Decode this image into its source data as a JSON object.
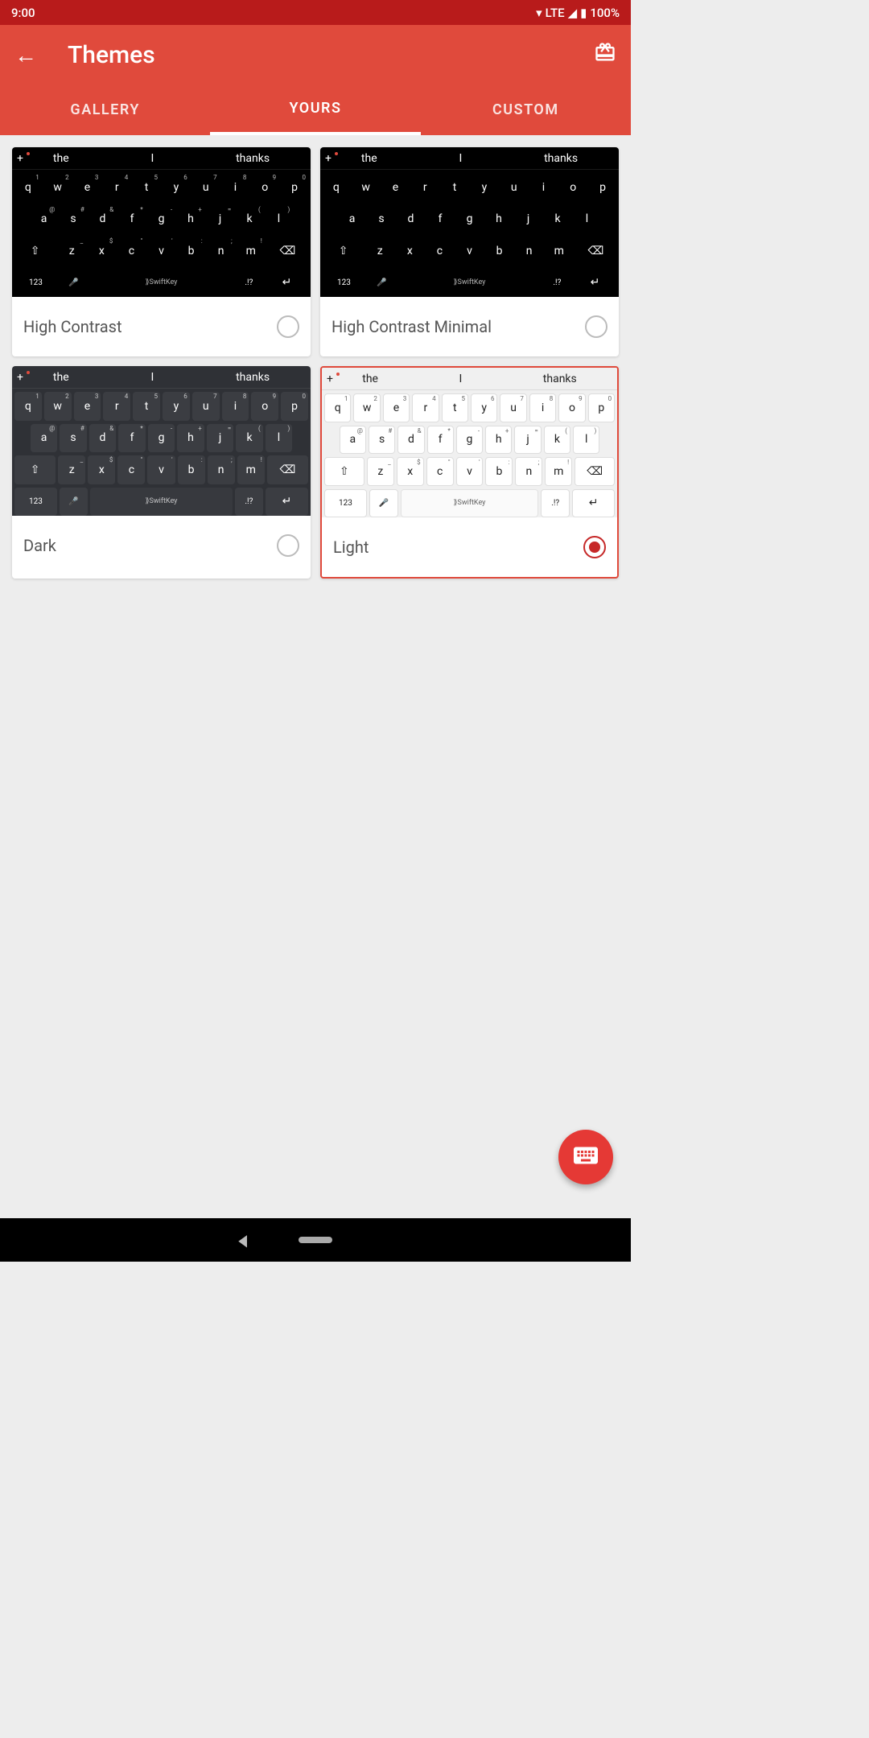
{
  "status": {
    "time": "9:00",
    "network": "LTE",
    "battery": "100%"
  },
  "app": {
    "title": "Themes"
  },
  "tabs": {
    "gallery": "GALLERY",
    "yours": "YOURS",
    "custom": "CUSTOM",
    "active": "yours"
  },
  "suggestions": {
    "s1": "the",
    "s2": "I",
    "s3": "thanks"
  },
  "keys": {
    "row1": [
      "q",
      "w",
      "e",
      "r",
      "t",
      "y",
      "u",
      "i",
      "o",
      "p"
    ],
    "row1nums": [
      "1",
      "2",
      "3",
      "4",
      "5",
      "6",
      "7",
      "8",
      "9",
      "0"
    ],
    "row2": [
      "a",
      "s",
      "d",
      "f",
      "g",
      "h",
      "j",
      "k",
      "l"
    ],
    "row2syms": [
      "@",
      "#",
      "&",
      "*",
      "-",
      "+",
      "=",
      "(",
      ")"
    ],
    "row3": [
      "z",
      "x",
      "c",
      "v",
      "b",
      "n",
      "m"
    ],
    "row3syms": [
      "_",
      "$",
      "\"",
      "'",
      ":",
      ";",
      "!"
    ],
    "numkey": "123",
    "brand": "SwiftKey"
  },
  "themes": {
    "hc": {
      "label": "High Contrast",
      "selected": false
    },
    "hcm": {
      "label": "High Contrast Minimal",
      "selected": false
    },
    "dark": {
      "label": "Dark",
      "selected": false
    },
    "light": {
      "label": "Light",
      "selected": true
    }
  }
}
